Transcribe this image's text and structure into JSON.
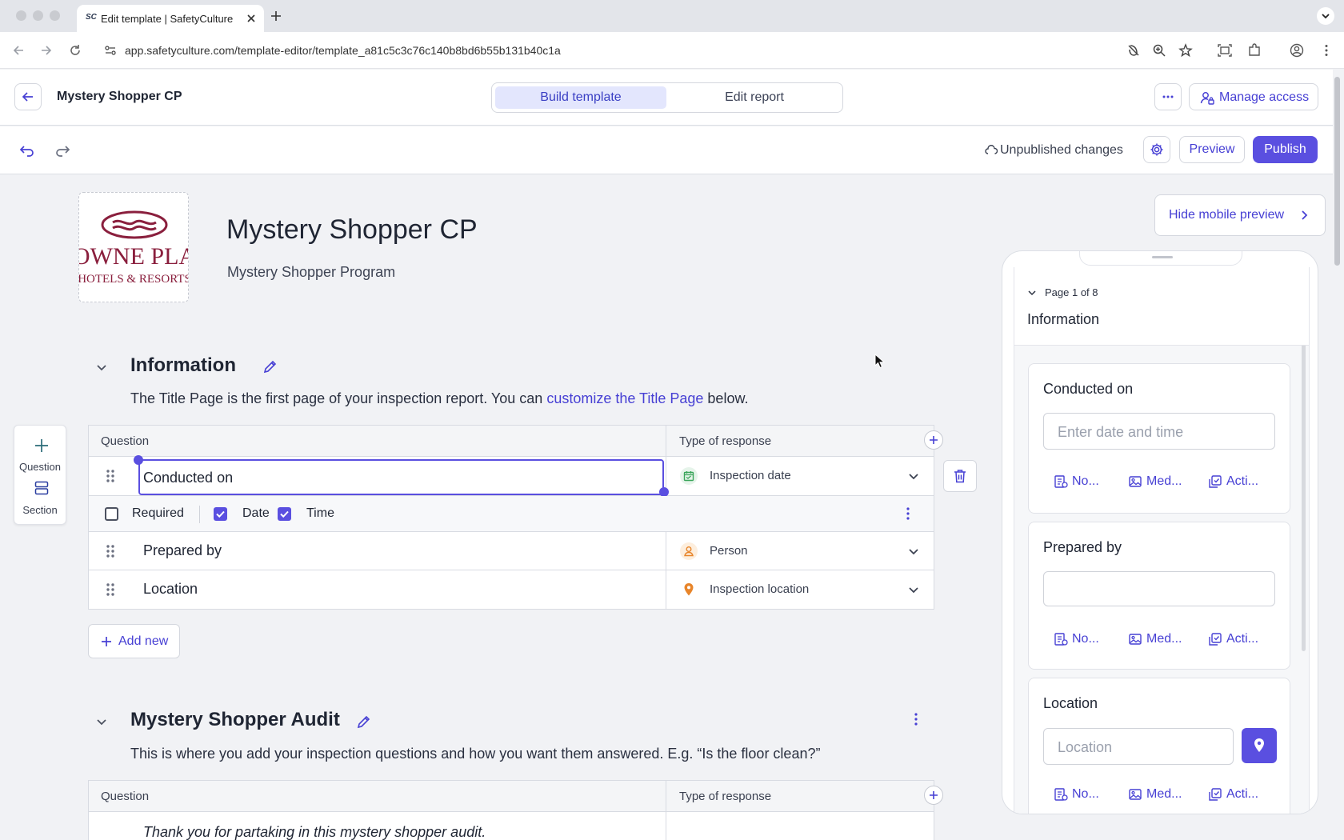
{
  "browser": {
    "tab_title": "Edit template | SafetyCulture",
    "favicon_text": "SC",
    "url": "app.safetyculture.com/template-editor/template_a81c5c3c76c140b8bd6b55b131b40c1a"
  },
  "header": {
    "template_name": "Mystery Shopper CP",
    "tabs": [
      {
        "label": "Build template",
        "active": true
      },
      {
        "label": "Edit report",
        "active": false
      }
    ],
    "manage_access": "Manage access"
  },
  "toolbar": {
    "status": "Unpublished changes",
    "preview": "Preview",
    "publish": "Publish"
  },
  "document": {
    "title": "Mystery Shopper CP",
    "subtitle": "Mystery Shopper Program",
    "logo_text": [
      "OWNE PLA",
      "HOTELS & RESORTS"
    ]
  },
  "sidebar": {
    "question": "Question",
    "section": "Section"
  },
  "columns": {
    "question": "Question",
    "response": "Type of response"
  },
  "sections": [
    {
      "title": "Information",
      "desc_before": "The Title Page is the first page of your inspection report. You can ",
      "desc_link": "customize the Title Page",
      "desc_after": " below.",
      "rows": [
        {
          "question": "Conducted on",
          "response": "Inspection date",
          "icon": "calendar-icon"
        },
        {
          "question": "Prepared by",
          "response": "Person",
          "icon": "person-icon"
        },
        {
          "question": "Location",
          "response": "Inspection location",
          "icon": "location-pin-icon"
        }
      ],
      "options": {
        "required": "Required",
        "date": "Date",
        "time": "Time"
      }
    },
    {
      "title": "Mystery Shopper Audit",
      "desc": "This is where you add your inspection questions and how you want them answered. E.g. “Is the floor clean?”",
      "rows": [
        {
          "question": "Thank you for partaking in this mystery shopper audit."
        }
      ]
    }
  ],
  "add_new": "Add new",
  "mobile": {
    "hide_label": "Hide mobile preview",
    "page_label": "Page 1 of 8",
    "page_title": "Information",
    "cards": [
      {
        "label": "Conducted on",
        "placeholder": "Enter date and time"
      },
      {
        "label": "Prepared by",
        "placeholder": ""
      },
      {
        "label": "Location",
        "placeholder": "Location"
      }
    ],
    "actions": [
      "No...",
      "Med...",
      "Acti..."
    ]
  },
  "colors": {
    "accent": "#5a4fe0",
    "link": "#4740d4",
    "date_green": "#3aa55a",
    "person_orange": "#e8852a"
  }
}
